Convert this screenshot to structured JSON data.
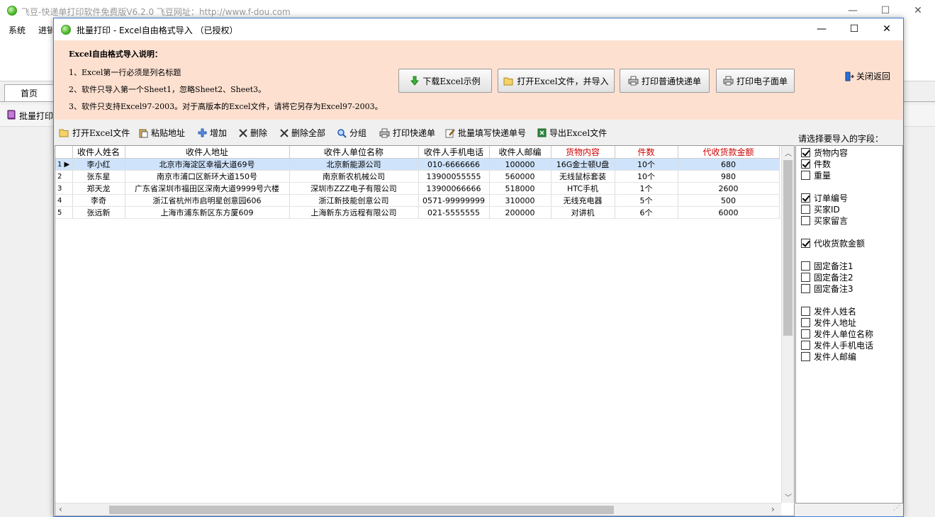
{
  "main": {
    "title": "飞豆-快递单打印软件免费版V6.2.0  飞豆网址：http://www.f-dou.com",
    "menu": [
      "系统",
      "进销"
    ],
    "tab": "首页",
    "sub_label": "批量打印",
    "win_min": "—",
    "win_max": "☐",
    "win_close": "✕"
  },
  "dialog": {
    "title": "批量打印 - Excel自由格式导入 （已授权）",
    "win_min": "—",
    "win_max": "☐",
    "win_close": "✕",
    "info": {
      "heading": "Excel自由格式导入说明：",
      "lines": [
        "1、Excel第一行必须是列名标题",
        "2、软件只导入第一个Sheet1，忽略Sheet2、Sheet3。",
        "3、软件只支持Excel97-2003。对于高版本的Excel文件，请将它另存为Excel97-2003。"
      ]
    },
    "buttons": {
      "download_sample": "下载Excel示例",
      "open_import": "打开Excel文件，并导入",
      "print_normal": "打印普通快递单",
      "print_electronic": "打印电子面单"
    },
    "close_return": "关闭返回",
    "toolbar": {
      "open_excel": "打开Excel文件",
      "paste_address": "粘贴地址",
      "add": "增加",
      "delete": "删除",
      "delete_all": "删除全部",
      "group": "分组",
      "print_express": "打印快递单",
      "batch_fill": "批量填写快递单号",
      "export_excel": "导出Excel文件"
    },
    "grid": {
      "columns": [
        "收件人姓名",
        "收件人地址",
        "收件人单位名称",
        "收件人手机电话",
        "收件人邮编",
        "货物内容",
        "件数",
        "代收货款金额"
      ],
      "rows": [
        {
          "idx": "1",
          "name": "李小红",
          "address": "北京市海淀区幸福大道69号",
          "company": "北京新能源公司",
          "phone": "010-6666666",
          "zip": "100000",
          "goods": "16G金士顿U盘",
          "qty": "10个",
          "cod": "680"
        },
        {
          "idx": "2",
          "name": "张东星",
          "address": "南京市浦口区新环大道150号",
          "company": "南京新农机械公司",
          "phone": "13900055555",
          "zip": "560000",
          "goods": "无线鼠标套装",
          "qty": "10个",
          "cod": "980"
        },
        {
          "idx": "3",
          "name": "郑天龙",
          "address": "广东省深圳市福田区深南大道9999号六楼",
          "company": "深圳市ZZZ电子有限公司",
          "phone": "13900066666",
          "zip": "518000",
          "goods": "HTC手机",
          "qty": "1个",
          "cod": "2600"
        },
        {
          "idx": "4",
          "name": "李奇",
          "address": "浙江省杭州市启明星创意园606",
          "company": "浙江新技能创意公司",
          "phone": "0571-99999999",
          "zip": "310000",
          "goods": "无线充电器",
          "qty": "5个",
          "cod": "500"
        },
        {
          "idx": "5",
          "name": "张远新",
          "address": "上海市浦东新区东方厦609",
          "company": "上海新东方远程有限公司",
          "phone": "021-5555555",
          "zip": "200000",
          "goods": "对讲机",
          "qty": "6个",
          "cod": "6000"
        }
      ]
    },
    "fields": {
      "label": "请选择要导入的字段：",
      "items": [
        {
          "label": "货物内容",
          "checked": true
        },
        {
          "label": "件数",
          "checked": true
        },
        {
          "label": "重量",
          "checked": false
        },
        {
          "label": "订单编号",
          "checked": true
        },
        {
          "label": "买家ID",
          "checked": false
        },
        {
          "label": "买家留言",
          "checked": false
        },
        {
          "label": "代收货款金额",
          "checked": true
        },
        {
          "label": "固定备注1",
          "checked": false
        },
        {
          "label": "固定备注2",
          "checked": false
        },
        {
          "label": "固定备注3",
          "checked": false
        },
        {
          "label": "发件人姓名",
          "checked": false
        },
        {
          "label": "发件人地址",
          "checked": false
        },
        {
          "label": "发件人单位名称",
          "checked": false
        },
        {
          "label": "发件人手机电话",
          "checked": false
        },
        {
          "label": "发件人邮编",
          "checked": false
        }
      ]
    }
  },
  "colors": {
    "accent": "#3b7bd8",
    "info_bg": "#fde0d0",
    "red_header": "#d00000",
    "selected_row": "#cfe3fb"
  }
}
